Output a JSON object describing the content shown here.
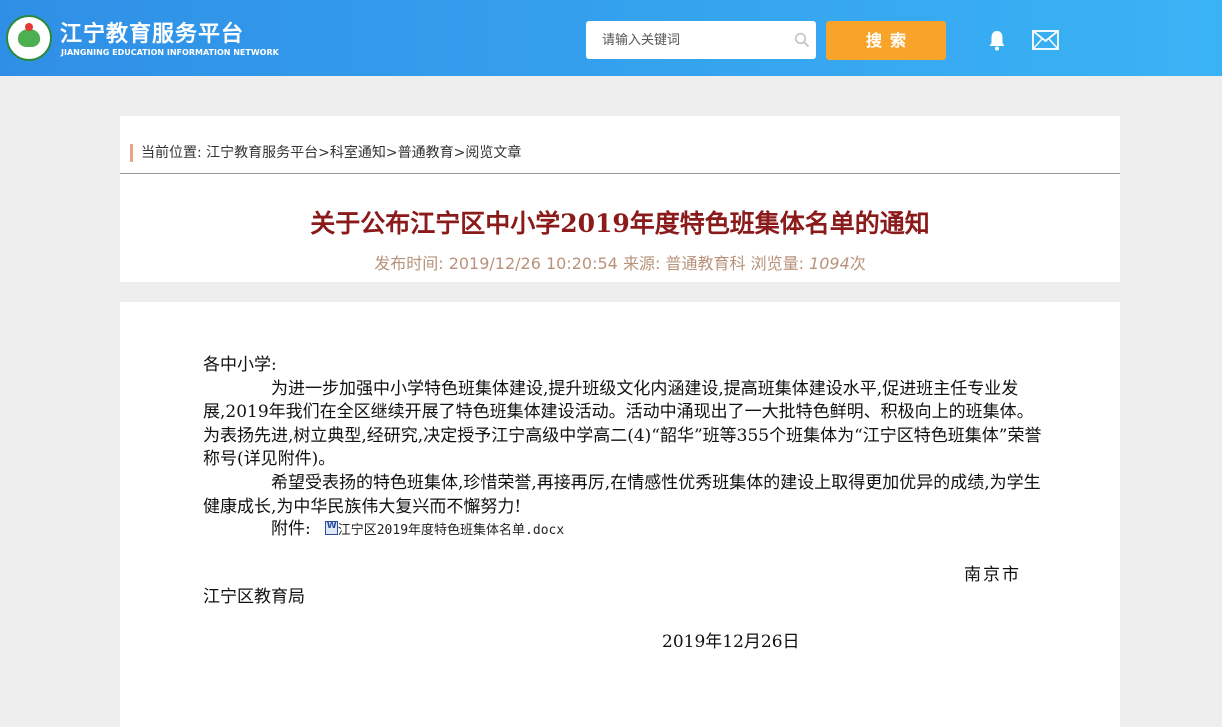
{
  "header": {
    "title": "江宁教育服务平台",
    "subtitle": "JIANGNING EDUCATION INFORMATION NETWORK",
    "search_placeholder": "请输入关键词",
    "search_button": "搜索",
    "icons": [
      "search-icon",
      "bell-icon",
      "mail-icon"
    ],
    "colors": {
      "header_start": "#2f8fe6",
      "header_end": "#3ab3f5",
      "search_button": "#f8a42b"
    }
  },
  "breadcrumb": {
    "label": "当前位置:",
    "path": "江宁教育服务平台>科室通知>普通教育>阅览文章"
  },
  "article": {
    "title": "关于公布江宁区中小学2019年度特色班集体名单的通知",
    "meta_time_label": "发布时间:",
    "meta_time": "2019/12/26 10:20:54",
    "meta_source_label": "来源:",
    "meta_source": "普通教育科",
    "meta_views_label": "浏览量:",
    "meta_views": "1094",
    "meta_views_unit": "次",
    "title_color": "#8b1a1a"
  },
  "content": {
    "salutation": "各中小学:",
    "paragraph1": "为进一步加强中小学特色班集体建设,提升班级文化内涵建设,提高班集体建设水平,促进班主任专业发展,2019年我们在全区继续开展了特色班集体建设活动。活动中涌现出了一大批特色鲜明、积极向上的班集体。为表扬先进,树立典型,经研究,决定授予江宁高级中学高二(4)“韶华”班等355个班集体为“江宁区特色班集体”荣誉称号(详见附件)。",
    "paragraph2": "希望受表扬的特色班集体,珍惜荣誉,再接再厉,在情感性优秀班集体的建设上取得更加优异的成绩,为学生健康成长,为中华民族伟大复兴而不懈努力!",
    "attachment_label": "附件:",
    "attachment_name": "江宁区2019年度特色班集体名单.docx",
    "sign_city": "南京市",
    "sign_org": "江宁区教育局",
    "sign_date": "2019年12月26日"
  }
}
